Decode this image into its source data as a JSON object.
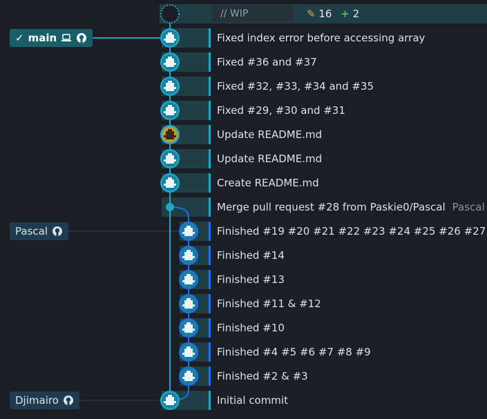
{
  "wip": {
    "label": "// WIP",
    "modified_count": "16",
    "added_count": "2"
  },
  "branches": {
    "main": "main",
    "pascal": "Pascal",
    "djimairo": "Djimairo"
  },
  "commits": [
    {
      "message": "Fixed index error before accessing array",
      "tag": ""
    },
    {
      "message": "Fixed #36 and #37",
      "tag": ""
    },
    {
      "message": "Fixed #32, #33, #34 and #35",
      "tag": ""
    },
    {
      "message": "Fixed #29, #30 and #31",
      "tag": ""
    },
    {
      "message": "Update README.md",
      "tag": ""
    },
    {
      "message": "Update README.md",
      "tag": ""
    },
    {
      "message": "Create README.md",
      "tag": ""
    },
    {
      "message": "Merge pull request #28 from Paskie0/Pascal",
      "tag": "Pascal"
    },
    {
      "message": "Finished #19 #20 #21 #22 #23 #24 #25 #26 #27",
      "tag": ""
    },
    {
      "message": "Finished #14",
      "tag": ""
    },
    {
      "message": "Finished #13",
      "tag": ""
    },
    {
      "message": "Finished #11 & #12",
      "tag": ""
    },
    {
      "message": "Finished #10",
      "tag": ""
    },
    {
      "message": "Finished #4 #5 #6 #7 #8 #9",
      "tag": ""
    },
    {
      "message": "Finished #2 & #3",
      "tag": ""
    },
    {
      "message": "Initial commit",
      "tag": ""
    }
  ],
  "colors": {
    "lane_main": "#1fa7c4",
    "lane_branch": "#1e6fe0",
    "stripe": "#1f3e46",
    "avatar_default": "#1b7fa0",
    "avatar_alt": "#c09a2a"
  }
}
